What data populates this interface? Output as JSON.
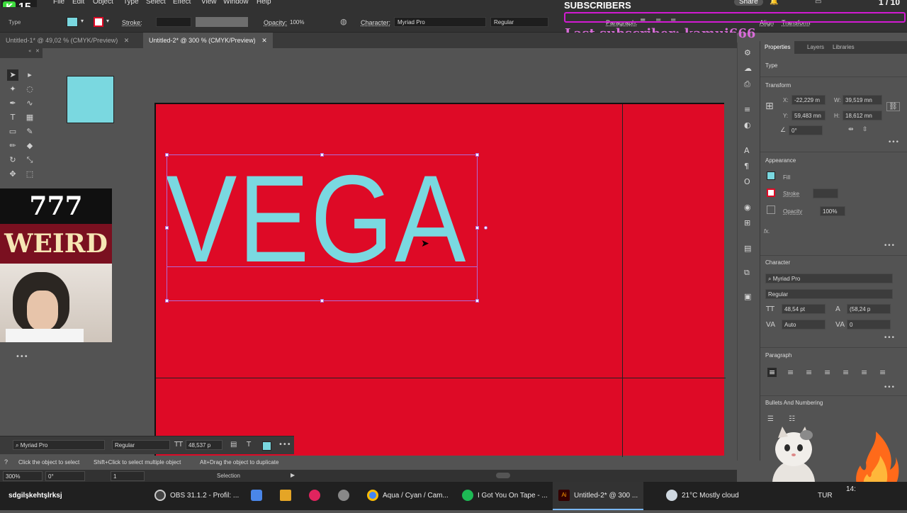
{
  "menubar": {
    "logo_number": "15",
    "items": [
      "File",
      "Edit",
      "Object",
      "Type",
      "Select",
      "Effect",
      "View",
      "Window",
      "Help"
    ],
    "share_label": "Share",
    "page_counter": "1 / 10"
  },
  "control_bar": {
    "mode_label": "Type",
    "fill_color": "#7ad8e0",
    "stroke_label": "Stroke:",
    "opacity_label": "Opacity:",
    "opacity_value": "100%",
    "character_label": "Character:",
    "font_family": "Myriad Pro",
    "font_style": "Regular",
    "paragraph_label": "Paragraph:",
    "align_label": "Align",
    "transform_label": "Transform"
  },
  "tabs": [
    {
      "label": "Untitled-1* @ 49,02 % (CMYK/Preview)",
      "active": false
    },
    {
      "label": "Untitled-2* @ 300 % (CMYK/Preview)",
      "active": true
    }
  ],
  "canvas": {
    "artboard_color": "#de0a26",
    "text": "VEGA",
    "text_color": "#7ad8e0",
    "swatch_color": "#7ad8e0"
  },
  "overlay": {
    "counter_text": "777",
    "weird_text": "WEIRD",
    "subscribers_title": "SUBSCRIBERS",
    "last_subscriber": "Last subscriber: kamui666"
  },
  "properties_panel": {
    "tabs": [
      "Properties",
      "Layers",
      "Libraries"
    ],
    "type_label": "Type",
    "transform_title": "Transform",
    "x_label": "X:",
    "x_value": "-22,229 m",
    "y_label": "Y:",
    "y_value": "59,483 mn",
    "w_label": "W:",
    "w_value": "39,519 mn",
    "h_label": "H:",
    "h_value": "18,612 mn",
    "rotate_value": "0°",
    "appearance_title": "Appearance",
    "fill_label": "Fill",
    "stroke_label": "Stroke",
    "opacity_label": "Opacity",
    "opacity_value": "100%",
    "fx_label": "fx.",
    "character_title": "Character",
    "font_family": "Myriad Pro",
    "font_style": "Regular",
    "font_size": "48,54 pt",
    "leading": "(58,24 p",
    "kerning": "Auto",
    "tracking": "0",
    "paragraph_title": "Paragraph",
    "bullets_title": "Bullets And Numbering"
  },
  "char_bar": {
    "font_family": "Myriad Pro",
    "font_style": "Regular",
    "font_size": "48,537 p"
  },
  "status": {
    "hint1": "Click the object to select",
    "hint2": "Shift+Click to select multiple object",
    "hint3": "Alt+Drag the object to duplicate",
    "zoom": "300%",
    "rotation": "0°",
    "artboard": "1",
    "tool": "Selection"
  },
  "taskbar": {
    "items": [
      {
        "label": "sdgilşkehtşlrksj",
        "color": "#d4338a"
      },
      {
        "label": "OBS 31.1.2 - Profil: ...",
        "color": "#444"
      },
      {
        "label": "",
        "color": "#4a86e8"
      },
      {
        "label": "",
        "color": "#e5a526"
      },
      {
        "label": "",
        "color": "#e0245e"
      },
      {
        "label": "",
        "color": "#888"
      },
      {
        "label": "Aqua / Cyan / Cam...",
        "color": "#4285f4"
      },
      {
        "label": "I Got You On Tape - ...",
        "color": "#1db954"
      },
      {
        "label": "Untitled-2* @ 300 ...",
        "color": "#330000"
      }
    ],
    "weather": "21°C  Mostly cloud",
    "lang": "TUR",
    "time": "14:"
  }
}
